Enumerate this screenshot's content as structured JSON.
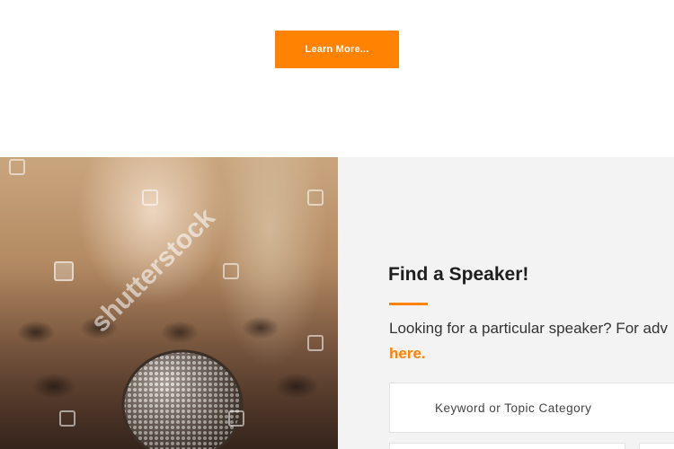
{
  "cta": {
    "learn_more_label": "Learn More..."
  },
  "hero_image": {
    "description_icon": "microphone-icon",
    "watermark_text": "shutterstock"
  },
  "find_speaker": {
    "title": "Find a Speaker!",
    "description": "Looking for a particular speaker? For adv",
    "link_text": "here.",
    "search_placeholder": "Keyword or Topic Category"
  },
  "colors": {
    "accent": "#ff8200",
    "panel_bg": "#f3f3f3",
    "heading": "#1e1e1e"
  }
}
